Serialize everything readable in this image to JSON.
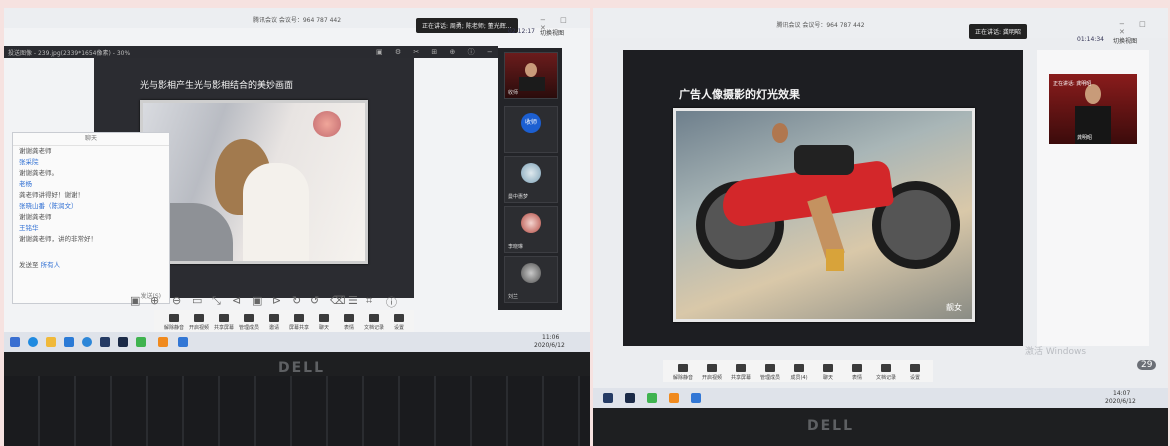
{
  "left": {
    "meeting_title": "腾讯会议  会议号：964 787 442",
    "speaking": "正在讲话: 周勇; 陈老师; 董光辉...",
    "clock": "02:12:17",
    "share_label": "切换视图",
    "viewer_title": "投送图像 - 239.jpg(2339*1654像素) - 30%",
    "slide_title": "光与影相产生光与影相结合的美妙画面",
    "chat": {
      "title": "聊天",
      "lines": [
        {
          "text": "谢谢龚老师",
          "blue": false
        },
        {
          "text": "张采院",
          "blue": true
        },
        {
          "text": "谢谢龚老师。",
          "blue": false
        },
        {
          "text": "老杨",
          "blue": true
        },
        {
          "text": "龚老师讲得好！谢谢！",
          "blue": false
        },
        {
          "text": "张晓山番（陈润文）",
          "blue": true
        },
        {
          "text": "谢谢龚老师",
          "blue": false
        },
        {
          "text": "王铭华",
          "blue": true
        },
        {
          "text": "谢谢龚老师，讲的非常好！",
          "blue": false
        }
      ],
      "send_to_label": "发送至",
      "send_to_value": "所有人",
      "send_button": "发送(S)"
    },
    "participants": [
      "收师",
      "收师",
      "曼中惠梦",
      "李晓琳",
      "刘兰"
    ],
    "meeting_bar": [
      "解除静音",
      "开启视频",
      "共享屏幕",
      "管理成员",
      "邀请",
      "屏幕共享",
      "聊天",
      "表情",
      "文档记录",
      "设置"
    ],
    "taskbar_clock": "11:06",
    "taskbar_date": "2020/6/12",
    "brand": "DELL"
  },
  "right": {
    "meeting_title": "腾讯会议  会议号：964 787 442",
    "speaking": "正在讲话: 龚明昭",
    "clock": "01:14:34",
    "share_label": "切换视图",
    "slide_title": "广告人像摄影的灯光效果",
    "watermark": "靓女",
    "speaker_panel_label": "正在讲话: 龚明昭",
    "speaker_name": "龚明昭",
    "windows_activate": "激活 Windows",
    "meeting_bar": [
      "解除静音",
      "开启视频",
      "共享屏幕",
      "管理成员",
      "成员(4)",
      "聊天",
      "表情",
      "文档记录",
      "设置"
    ],
    "badge": "29",
    "taskbar_clock": "14:07",
    "taskbar_date": "2020/6/12",
    "brand": "DELL"
  },
  "colors": {
    "page_bg": "#f6e2e0",
    "bezel": "#1e1f21",
    "accent": "#2f6fd3",
    "motorcycle_red": "#d3272a"
  }
}
